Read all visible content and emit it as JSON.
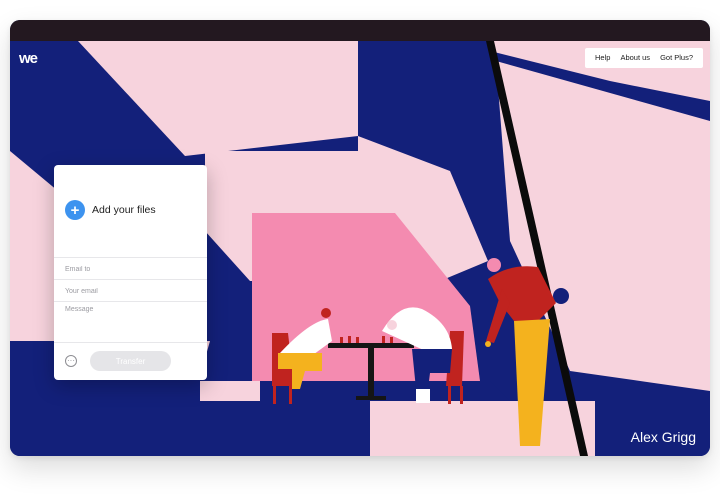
{
  "brand": {
    "logo_text": "we"
  },
  "nav": {
    "help": "Help",
    "about": "About us",
    "plus": "Got Plus?"
  },
  "upload": {
    "add_label": "Add your files",
    "plus_symbol": "+",
    "email_to_placeholder": "Email to",
    "your_email_placeholder": "Your email",
    "message_placeholder": "Message",
    "options_symbol": "···",
    "transfer_label": "Transfer"
  },
  "artwork": {
    "credit": "Alex Grigg"
  },
  "colors": {
    "navy": "#13207a",
    "pink_light": "#f7d3dd",
    "pink_hot": "#f48bb0",
    "accent_blue": "#3d93ef",
    "red": "#c0231f",
    "yellow": "#f4b21e",
    "topbar": "#231820"
  },
  "icons": {
    "add": "plus-circle-icon",
    "options": "more-options-icon"
  }
}
